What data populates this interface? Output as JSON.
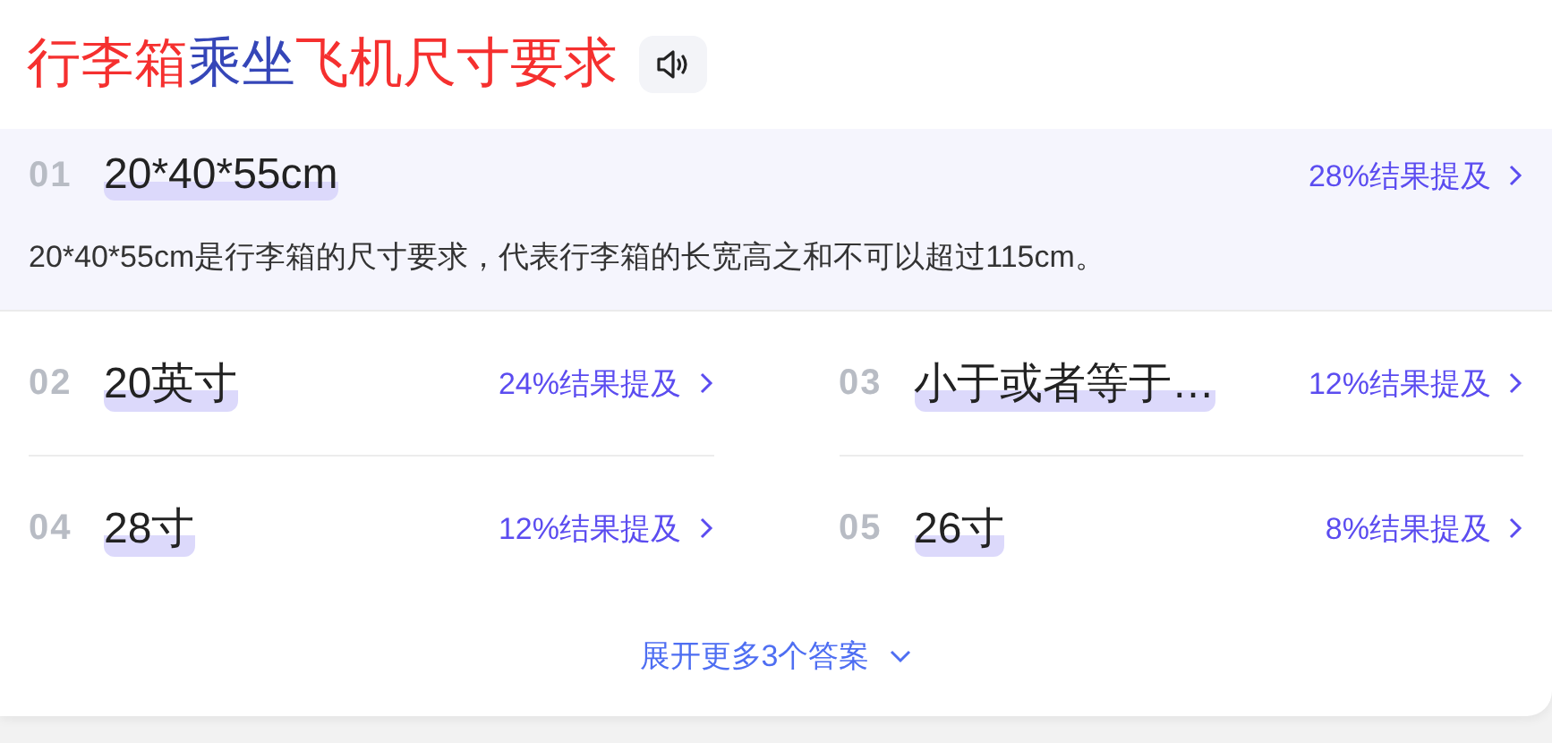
{
  "title_parts": [
    {
      "text": "行李箱",
      "color": "#f5302f"
    },
    {
      "text": "乘坐",
      "color": "#3546b8"
    },
    {
      "text": "飞机尺寸要求",
      "color": "#f5302f"
    }
  ],
  "answers": [
    {
      "rank": "01",
      "text": "20*40*55cm",
      "mention": "28%结果提及",
      "expanded": true,
      "description": "20*40*55cm是行李箱的尺寸要求，代表行李箱的长宽高之和不可以超过115cm。"
    },
    {
      "rank": "02",
      "text": "20英寸",
      "mention": "24%结果提及"
    },
    {
      "rank": "03",
      "text": "小于或者等于…",
      "mention": "12%结果提及"
    },
    {
      "rank": "04",
      "text": "28寸",
      "mention": "12%结果提及"
    },
    {
      "rank": "05",
      "text": "26寸",
      "mention": "8%结果提及"
    }
  ],
  "more_link": "展开更多3个答案"
}
